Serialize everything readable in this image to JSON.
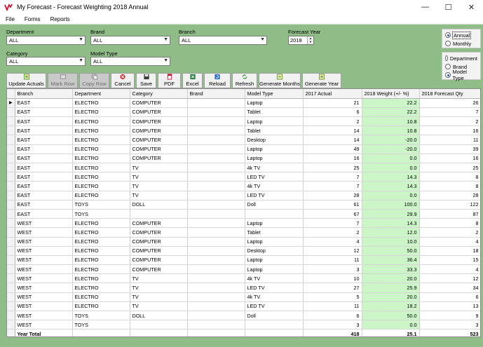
{
  "window": {
    "title": "My Forecast - Forecast Weighting 2018 Annual",
    "minimize_glyph": "—",
    "maximize_glyph": "☐",
    "close_glyph": "✕"
  },
  "menu": [
    "File",
    "Forms",
    "Reports"
  ],
  "filters": {
    "department": {
      "label": "Department",
      "value": "ALL"
    },
    "brand": {
      "label": "Brand",
      "value": "ALL"
    },
    "branch": {
      "label": "Branch",
      "value": "ALL"
    },
    "forecast_year": {
      "label": "Forecast Year",
      "value": "2018"
    },
    "category": {
      "label": "Category",
      "value": "ALL"
    },
    "model_type": {
      "label": "Model Type",
      "value": "ALL"
    }
  },
  "period_options": {
    "annual": "Annual",
    "monthly": "Monthly",
    "selected": "annual"
  },
  "group_options": {
    "department": "Department",
    "brand": "Brand",
    "model_type": "Model Type",
    "selected": "model_type"
  },
  "toolbar": [
    {
      "key": "update-actuals",
      "label": "Update Actuals",
      "enabled": true,
      "icon": "update-actuals-icon",
      "color": "#5a9e3a"
    },
    {
      "key": "mark-row",
      "label": "Mark Row",
      "enabled": false,
      "icon": "mark-row-icon",
      "color": "#7a7a7a"
    },
    {
      "key": "copy-row",
      "label": "Copy Row",
      "enabled": false,
      "icon": "copy-row-icon",
      "color": "#7a7a7a"
    },
    {
      "key": "cancel",
      "label": "Cancel",
      "enabled": true,
      "icon": "cancel-icon",
      "color": "#d0282a"
    },
    {
      "key": "save",
      "label": "Save",
      "enabled": true,
      "icon": "save-icon",
      "color": "#3a3a3a"
    },
    {
      "key": "pdf",
      "label": "PDF",
      "enabled": true,
      "icon": "pdf-icon",
      "color": "#c8102e"
    },
    {
      "key": "excel",
      "label": "Excel",
      "enabled": true,
      "icon": "excel-icon",
      "color": "#1d7a3c"
    },
    {
      "key": "reload",
      "label": "Reload",
      "enabled": true,
      "icon": "reload-icon",
      "color": "#2b6cc4"
    },
    {
      "key": "refresh",
      "label": "Refresh",
      "enabled": true,
      "icon": "refresh-icon",
      "color": "#2a9a2a"
    },
    {
      "key": "generate-months",
      "label": "Generate Months",
      "enabled": true,
      "icon": "generate-months-icon",
      "color": "#6a9a3a"
    },
    {
      "key": "generate-year",
      "label": "Generate Year",
      "enabled": true,
      "icon": "generate-year-icon",
      "color": "#6a9a3a"
    }
  ],
  "grid": {
    "columns": [
      "Branch",
      "Department",
      "Category",
      "Brand",
      "Model Type",
      "2017 Actual",
      "2018 Weight (+/- %)",
      "2018 Forecast Qty"
    ],
    "rows": [
      [
        "EAST",
        "ELECTRO",
        "COMPUTER",
        "",
        "Laptop",
        "21",
        "22.2",
        "26"
      ],
      [
        "EAST",
        "ELECTRO",
        "COMPUTER",
        "",
        "Tablet",
        "6",
        "22.2",
        "7"
      ],
      [
        "EAST",
        "ELECTRO",
        "COMPUTER",
        "",
        "Laptop",
        "2",
        "10.8",
        "2"
      ],
      [
        "EAST",
        "ELECTRO",
        "COMPUTER",
        "",
        "Tablet",
        "14",
        "10.8",
        "16"
      ],
      [
        "EAST",
        "ELECTRO",
        "COMPUTER",
        "",
        "Desktop",
        "14",
        "-20.0",
        "11"
      ],
      [
        "EAST",
        "ELECTRO",
        "COMPUTER",
        "",
        "Laptop",
        "49",
        "-20.0",
        "39"
      ],
      [
        "EAST",
        "ELECTRO",
        "COMPUTER",
        "",
        "Laptop",
        "16",
        "0.0",
        "16"
      ],
      [
        "EAST",
        "ELECTRO",
        "TV",
        "",
        "4k TV",
        "25",
        "0.0",
        "25"
      ],
      [
        "EAST",
        "ELECTRO",
        "TV",
        "",
        "LED TV",
        "7",
        "14.3",
        "8"
      ],
      [
        "EAST",
        "ELECTRO",
        "TV",
        "",
        "4k TV",
        "7",
        "14.3",
        "8"
      ],
      [
        "EAST",
        "ELECTRO",
        "TV",
        "",
        "LED TV",
        "28",
        "0.0",
        "28"
      ],
      [
        "EAST",
        "TOYS",
        "DOLL",
        "",
        "Doll",
        "61",
        "100.0",
        "122"
      ],
      [
        "EAST",
        "TOYS",
        "",
        "",
        "",
        "67",
        "29.9",
        "87"
      ],
      [
        "WEST",
        "ELECTRO",
        "COMPUTER",
        "",
        "Laptop",
        "7",
        "14.3",
        "8"
      ],
      [
        "WEST",
        "ELECTRO",
        "COMPUTER",
        "",
        "Tablet",
        "2",
        "12.0",
        "2"
      ],
      [
        "WEST",
        "ELECTRO",
        "COMPUTER",
        "",
        "Laptop",
        "4",
        "10.0",
        "4"
      ],
      [
        "WEST",
        "ELECTRO",
        "COMPUTER",
        "",
        "Desktop",
        "12",
        "50.0",
        "18"
      ],
      [
        "WEST",
        "ELECTRO",
        "COMPUTER",
        "",
        "Laptop",
        "11",
        "36.4",
        "15"
      ],
      [
        "WEST",
        "ELECTRO",
        "COMPUTER",
        "",
        "Laptop",
        "3",
        "33.3",
        "4"
      ],
      [
        "WEST",
        "ELECTRO",
        "TV",
        "",
        "4k TV",
        "10",
        "20.0",
        "12"
      ],
      [
        "WEST",
        "ELECTRO",
        "TV",
        "",
        "LED TV",
        "27",
        "25.9",
        "34"
      ],
      [
        "WEST",
        "ELECTRO",
        "TV",
        "",
        "4k TV",
        "5",
        "20.0",
        "6"
      ],
      [
        "WEST",
        "ELECTRO",
        "TV",
        "",
        "LED TV",
        "11",
        "18.2",
        "13"
      ],
      [
        "WEST",
        "TOYS",
        "DOLL",
        "",
        "Doll",
        "6",
        "50.0",
        "9"
      ],
      [
        "WEST",
        "TOYS",
        "",
        "",
        "",
        "3",
        "0.0",
        "3"
      ]
    ],
    "total": {
      "label": "Year Total",
      "actual": "418",
      "weight": "25.1",
      "forecast": "523"
    },
    "current_row_marker": "▶"
  },
  "colors": {
    "background": "#8fbc87",
    "weight_cell": "#ccf5c8",
    "app_icon": "#c8102e"
  }
}
